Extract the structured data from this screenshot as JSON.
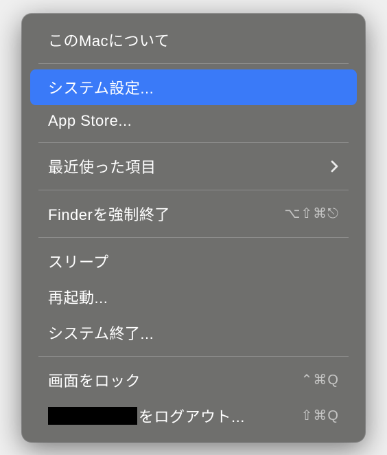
{
  "menu": {
    "about": "このMacについて",
    "system_settings": "システム設定...",
    "app_store": "App Store...",
    "recent_items": "最近使った項目",
    "force_quit": "Finderを強制終了",
    "force_quit_shortcut": "⌥⇧⌘⎋",
    "sleep": "スリープ",
    "restart": "再起動...",
    "shutdown": "システム終了...",
    "lock_screen": "画面をロック",
    "lock_screen_shortcut": "⌃⌘Q",
    "logout_suffix": "をログアウト...",
    "logout_shortcut": "⇧⌘Q"
  },
  "state": {
    "highlighted": "system_settings"
  }
}
